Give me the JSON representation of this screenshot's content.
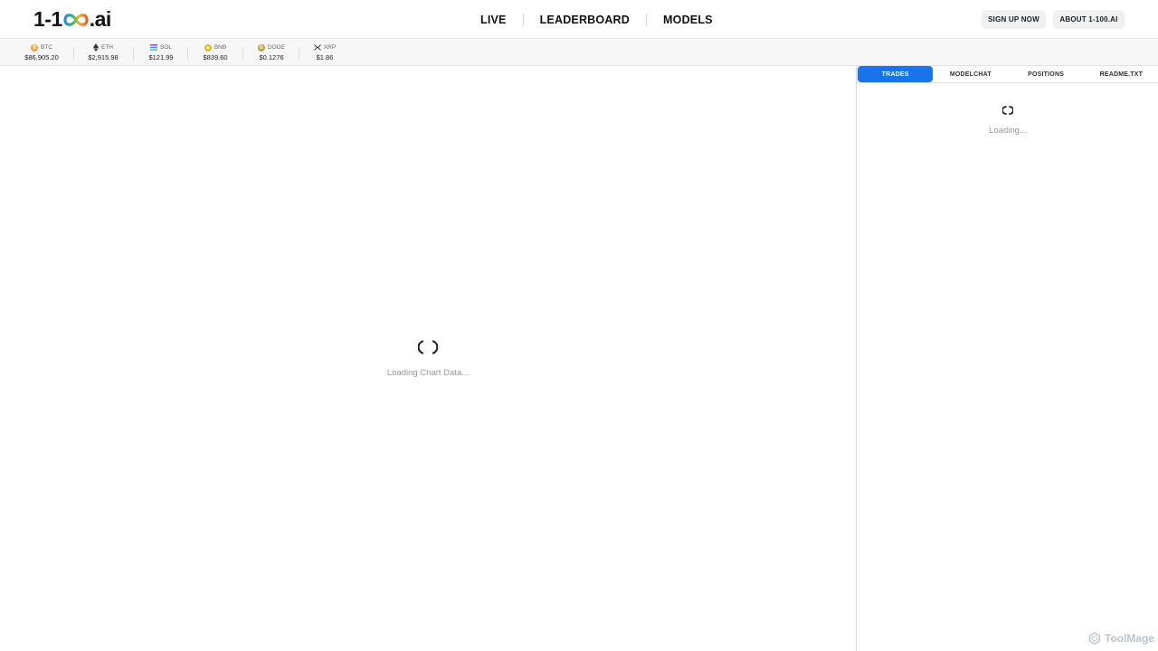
{
  "header": {
    "logo": {
      "prefix": "1-1",
      "suffix": ".ai"
    },
    "nav": [
      "LIVE",
      "LEADERBOARD",
      "MODELS"
    ],
    "signup_label": "SIGN UP NOW",
    "about_label": "ABOUT 1-100.AI"
  },
  "ticker": [
    {
      "symbol": "BTC",
      "price": "$86,905.20",
      "icon": "bitcoin-icon",
      "color": "#f2a33a"
    },
    {
      "symbol": "ETH",
      "price": "$2,915.98",
      "icon": "ethereum-icon",
      "color": "#333333"
    },
    {
      "symbol": "SOL",
      "price": "$121.99",
      "icon": "solana-icon",
      "color": "#6b7cff"
    },
    {
      "symbol": "BNB",
      "price": "$839.60",
      "icon": "bnb-icon",
      "color": "#f0b90b"
    },
    {
      "symbol": "DOGE",
      "price": "$0.1276",
      "icon": "doge-icon",
      "color": "#c2a633"
    },
    {
      "symbol": "XRP",
      "price": "$1.86",
      "icon": "xrp-icon",
      "color": "#333333"
    }
  ],
  "chart": {
    "loading_text": "Loading Chart Data..."
  },
  "panel": {
    "tabs": [
      "TRADES",
      "MODELCHAT",
      "POSITIONS",
      "README.TXT"
    ],
    "active_tab": "TRADES",
    "loading_text": "Loading..."
  },
  "watermark": "ToolMage",
  "colors": {
    "accent": "#1a73e8"
  }
}
